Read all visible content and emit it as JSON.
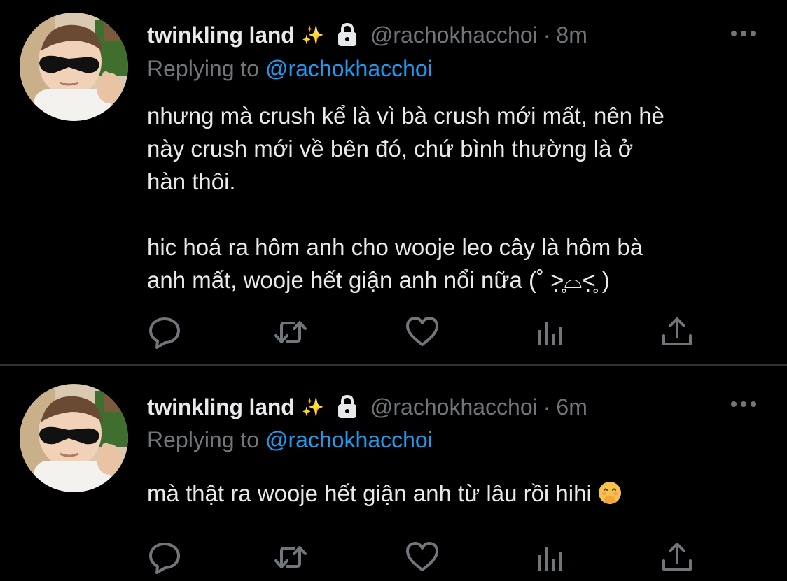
{
  "tweets": [
    {
      "display_name": "twinkling land",
      "sparkle_icon": "✨",
      "handle": "@rachokhacchoi",
      "separator": "·",
      "time": "8m",
      "replying_prefix": "Replying to ",
      "replying_to": "@rachokhacchoi",
      "text": "nhưng mà crush kể là vì bà crush mới mất, nên hè\nnày crush mới về bên đó, chứ bình thường là ở\nhàn thôi.\n\nhic hoá ra hôm anh cho wooje leo cây là hôm bà\nanh mất, wooje hết giận anh nổi nữa (˚ ˃̣̣̥⌓˂̣̣̥ )",
      "trailing_emoji": ""
    },
    {
      "display_name": "twinkling land",
      "sparkle_icon": "✨",
      "handle": "@rachokhacchoi",
      "separator": "·",
      "time": "6m",
      "replying_prefix": "Replying to ",
      "replying_to": "@rachokhacchoi",
      "text": "mà thật ra wooje hết giận anh từ lâu rồi hihi ",
      "trailing_emoji": "face-with-hand-over-mouth-emoji"
    }
  ],
  "icons": {
    "more": "more-icon",
    "lock": "lock-icon",
    "reply": "reply-icon",
    "retweet": "retweet-icon",
    "like": "heart-icon",
    "analytics": "analytics-icon",
    "share": "share-icon"
  },
  "colors": {
    "background": "#000000",
    "text": "#e7e9ea",
    "secondary": "#71767b",
    "link": "#1d9bf0",
    "divider": "#2f3336"
  }
}
